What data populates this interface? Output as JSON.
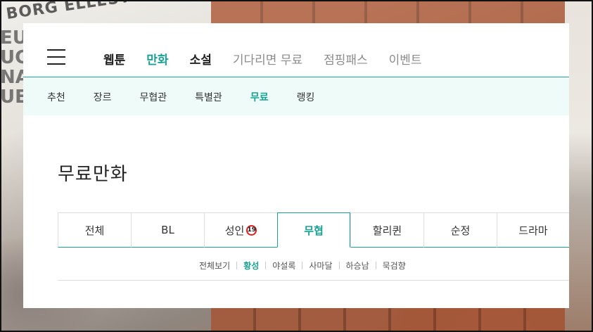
{
  "background": {
    "scribble_line1": "BORG  ELLESTOU",
    "scribble_line2": "EU\nUG\nNA\nUE"
  },
  "header": {
    "menu_icon": "hamburger-menu-icon",
    "nav": [
      {
        "label": "웹툰",
        "style": "strong"
      },
      {
        "label": "만화",
        "style": "active"
      },
      {
        "label": "소설",
        "style": "strong"
      },
      {
        "label": "기다리면 무료",
        "style": "muted"
      },
      {
        "label": "점핑패스",
        "style": "muted"
      },
      {
        "label": "이벤트",
        "style": "muted"
      }
    ]
  },
  "subnav": [
    {
      "label": "추천",
      "active": false
    },
    {
      "label": "장르",
      "active": false
    },
    {
      "label": "무협관",
      "active": false
    },
    {
      "label": "특별관",
      "active": false
    },
    {
      "label": "무료",
      "active": true
    },
    {
      "label": "랭킹",
      "active": false
    }
  ],
  "page_title": "무료만화",
  "tabs": [
    {
      "label": "전체",
      "active": false
    },
    {
      "label": "BL",
      "active": false
    },
    {
      "label": "성인",
      "active": false,
      "badge": "19"
    },
    {
      "label": "무협",
      "active": true
    },
    {
      "label": "할리퀸",
      "active": false
    },
    {
      "label": "순정",
      "active": false
    },
    {
      "label": "드라마",
      "active": false
    }
  ],
  "filters": [
    {
      "label": "전체보기",
      "active": false
    },
    {
      "label": "황성",
      "active": true
    },
    {
      "label": "야설록",
      "active": false
    },
    {
      "label": "사마달",
      "active": false
    },
    {
      "label": "하승남",
      "active": false
    },
    {
      "label": "묵검향",
      "active": false
    }
  ],
  "colors": {
    "accent": "#1aa394",
    "subbar_bg": "#eefbf8",
    "adult_badge_ring": "#e02020"
  }
}
